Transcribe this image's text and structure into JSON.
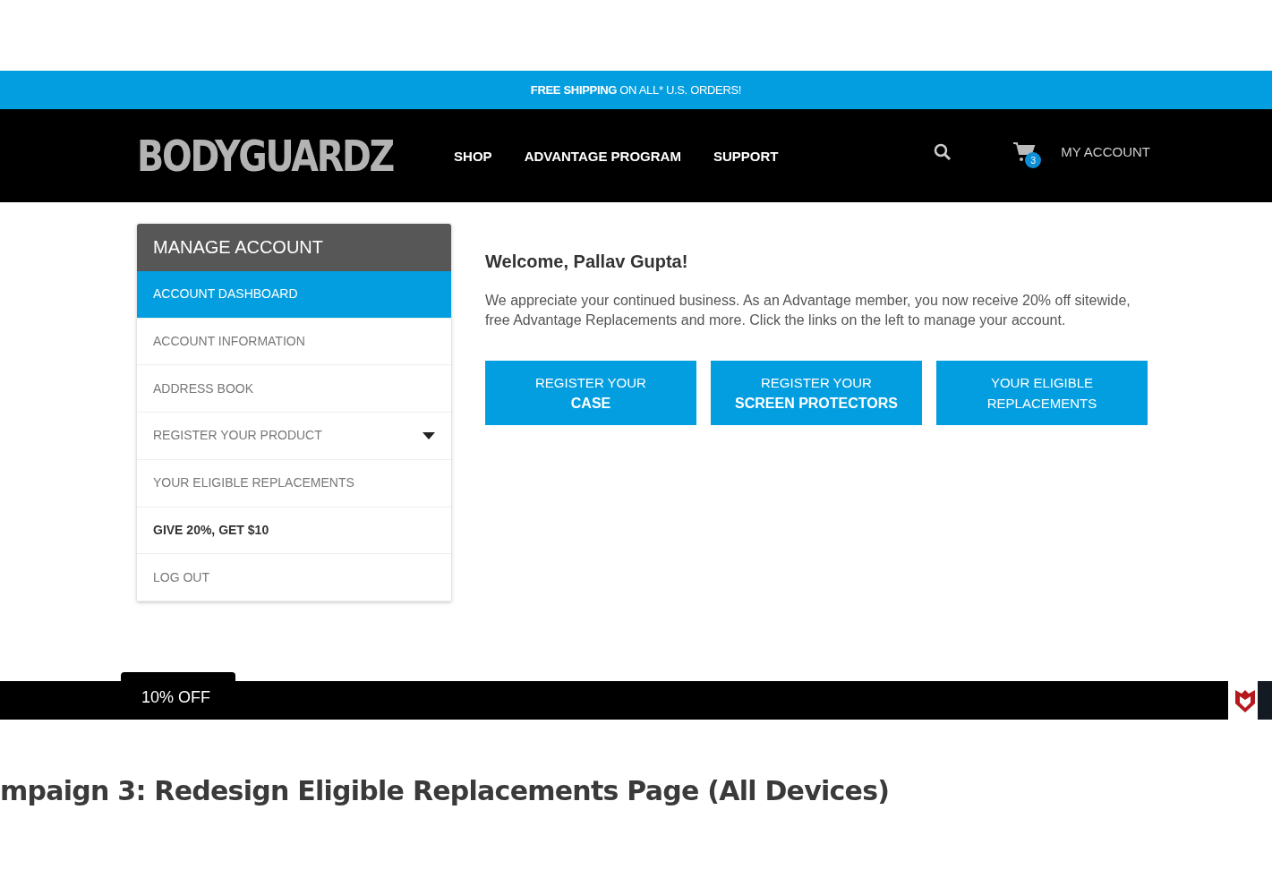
{
  "promo_bar": {
    "text": "**FREE SHIPPING** ON ALL* U.S. ORDERS!"
  },
  "header": {
    "logo": "BODYGUARDZ",
    "nav": [
      {
        "label": "SHOP"
      },
      {
        "label": "ADVANTAGE PROGRAM"
      },
      {
        "label": "SUPPORT"
      }
    ],
    "cart_count": "3",
    "account_link": "MY ACCOUNT"
  },
  "sidebar": {
    "title": "MANAGE ACCOUNT",
    "items": [
      {
        "label": "ACCOUNT DASHBOARD",
        "selected": true,
        "bold": false,
        "has_dropdown": false
      },
      {
        "label": "ACCOUNT INFORMATION",
        "selected": false,
        "bold": false,
        "has_dropdown": false
      },
      {
        "label": "ADDRESS BOOK",
        "selected": false,
        "bold": false,
        "has_dropdown": false
      },
      {
        "label": "REGISTER YOUR PRODUCT",
        "selected": false,
        "bold": false,
        "has_dropdown": true
      },
      {
        "label": "YOUR ELIGIBLE REPLACEMENTS",
        "selected": false,
        "bold": false,
        "has_dropdown": false
      },
      {
        "label": "GIVE 20%, GET $10",
        "selected": false,
        "bold": true,
        "has_dropdown": false
      },
      {
        "label": "LOG OUT",
        "selected": false,
        "bold": false,
        "has_dropdown": false
      }
    ]
  },
  "welcome": {
    "heading": "Welcome, Pallav Gupta!",
    "text": "We appreciate your continued business. As an Advantage member, you now receive 20% off sitewide, free Advantage Replacements and more. Click the links on the left to manage your account."
  },
  "actions": [
    {
      "line1": "REGISTER YOUR",
      "line2": "CASE",
      "line2_bold": true
    },
    {
      "line1": "REGISTER YOUR",
      "line2": "SCREEN PROTECTORS",
      "line2_bold": true
    },
    {
      "line1": "YOUR ELIGIBLE",
      "line2": "REPLACEMENTS",
      "line2_bold": false
    }
  ],
  "footer_bar": {
    "tab": "10% OFF"
  },
  "caption": "mpaign 3: Redesign Eligible Replacements Page (All Devices)"
}
